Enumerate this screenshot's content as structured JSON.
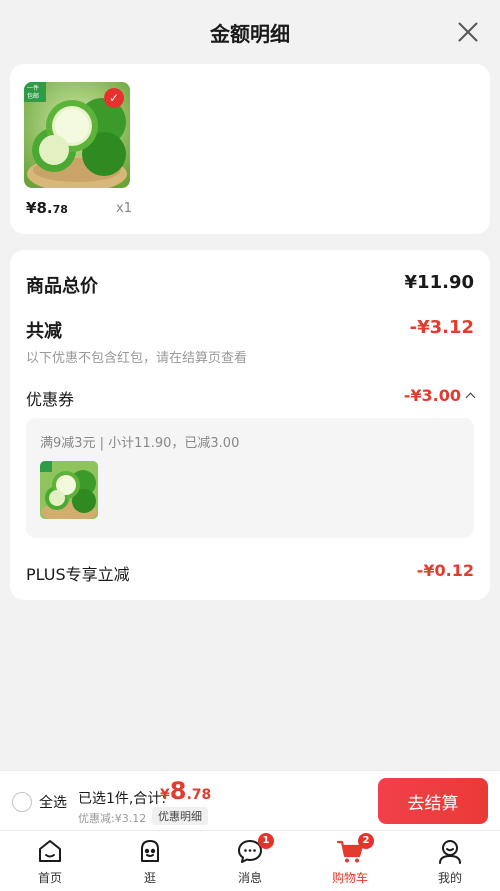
{
  "header": {
    "title": "金额明细"
  },
  "product": {
    "price_currency": "¥",
    "price_int": "8.",
    "price_dec": "78",
    "quantity": "x1",
    "corner_tag": "一件\n包邮"
  },
  "details": {
    "total_label": "商品总价",
    "total_value": "¥11.90",
    "reduce_label": "共减",
    "reduce_value": "-¥3.12",
    "reduce_note": "以下优惠不包含红包，请在结算页查看",
    "coupon_label": "优惠券",
    "coupon_value": "-¥3.00",
    "coupon_desc": "满9减3元 | 小计11.90，已减3.00",
    "plus_label": "PLUS专享立减",
    "plus_value": "-¥0.12"
  },
  "checkout": {
    "select_all": "全选",
    "selected_summary": "已选1件,合计:",
    "sum_currency": "¥",
    "sum_int": "8",
    "sum_dec": ".78",
    "discount_line": "优惠减:¥3.12",
    "detail_tag": "优惠明细",
    "checkout_button": "去结算"
  },
  "tabs": [
    {
      "label": "首页",
      "icon": "home-icon",
      "badge": ""
    },
    {
      "label": "逛",
      "icon": "stroll-face-icon",
      "badge": ""
    },
    {
      "label": "消息",
      "icon": "message-icon",
      "badge": "1"
    },
    {
      "label": "购物车",
      "icon": "cart-icon",
      "badge": "2"
    },
    {
      "label": "我的",
      "icon": "profile-icon",
      "badge": ""
    }
  ],
  "colors": {
    "accent": "#e33b2e",
    "badge": "#e8312d",
    "background": "#f2f2f2"
  }
}
